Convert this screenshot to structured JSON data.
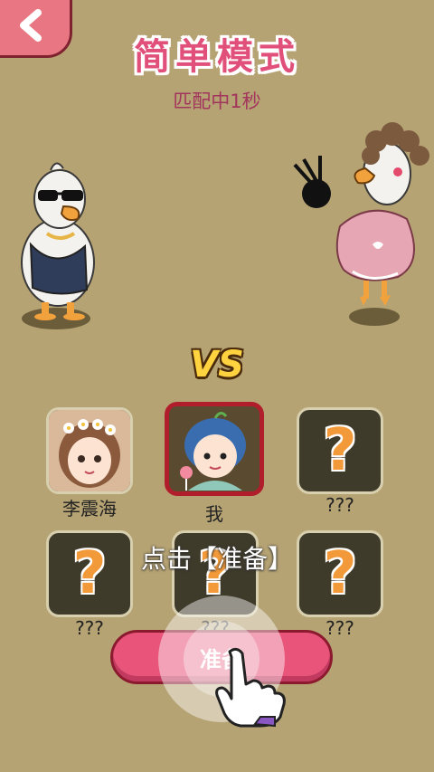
{
  "header": {
    "back_icon": "back-arrow-icon",
    "title": "简单模式",
    "subtitle": "匹配中1秒"
  },
  "battle": {
    "vs_label": "VS",
    "left_character": "cool-goose-sunglasses",
    "right_character": "goose-curly-hair-pink-dress"
  },
  "players": [
    {
      "name": "李震海",
      "avatar": "girl-flower-crown-avatar",
      "is_self": false
    },
    {
      "name": "我",
      "avatar": "boy-blue-hair-avatar",
      "is_self": true
    },
    {
      "name": "???",
      "avatar": "question-mark-icon",
      "is_self": false
    },
    {
      "name": "???",
      "avatar": "question-mark-icon",
      "is_self": false
    },
    {
      "name": "???",
      "avatar": "question-mark-icon",
      "is_self": false
    },
    {
      "name": "???",
      "avatar": "question-mark-icon",
      "is_self": false
    }
  ],
  "question_mark": "?",
  "hint": "点击【准备】",
  "ready_button": {
    "label": "准备",
    "pointer_icon": "tap-hand-icon"
  },
  "colors": {
    "background": "#b6a374",
    "accent_pink": "#e8547a",
    "self_border": "#b01e2c",
    "question_orange": "#f29a3a"
  }
}
